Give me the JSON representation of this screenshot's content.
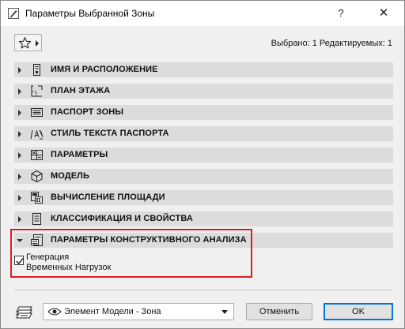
{
  "window": {
    "title": "Параметры Выбранной Зоны",
    "help_label": "?",
    "close_label": "✕"
  },
  "toolbar": {
    "selected_info": "Выбрано: 1 Редактируемых: 1"
  },
  "panels": [
    {
      "label": "ИМЯ И РАСПОЛОЖЕНИЕ",
      "icon": "name-location-icon",
      "expanded": false
    },
    {
      "label": "ПЛАН ЭТАЖА",
      "icon": "floor-plan-icon",
      "expanded": false
    },
    {
      "label": "ПАСПОРТ ЗОНЫ",
      "icon": "zone-stamp-icon",
      "expanded": false
    },
    {
      "label": "СТИЛЬ ТЕКСТА ПАСПОРТА",
      "icon": "text-style-icon",
      "expanded": false
    },
    {
      "label": "ПАРАМЕТРЫ",
      "icon": "parameters-icon",
      "expanded": false
    },
    {
      "label": "МОДЕЛЬ",
      "icon": "model-icon",
      "expanded": false
    },
    {
      "label": "ВЫЧИСЛЕНИЕ ПЛОЩАДИ",
      "icon": "area-calculation-icon",
      "expanded": false
    },
    {
      "label": "КЛАССИФИКАЦИЯ И СВОЙСТВА",
      "icon": "classification-icon",
      "expanded": false
    },
    {
      "label": "ПАРАМЕТРЫ КОНСТРУКТИВНОГО АНАЛИЗА",
      "icon": "structural-analysis-icon",
      "expanded": true
    }
  ],
  "structural": {
    "checkbox_line1": "Генерация",
    "checkbox_line2": "Временных Нагрузок",
    "checked": true
  },
  "footer": {
    "view_select_value": "Элемент Модели - Зона",
    "cancel_label": "Отменить",
    "ok_label": "OK"
  },
  "colors": {
    "highlight": "#e01b24",
    "panel_header": "#dcdcdc",
    "ok_border": "#0078d7"
  }
}
